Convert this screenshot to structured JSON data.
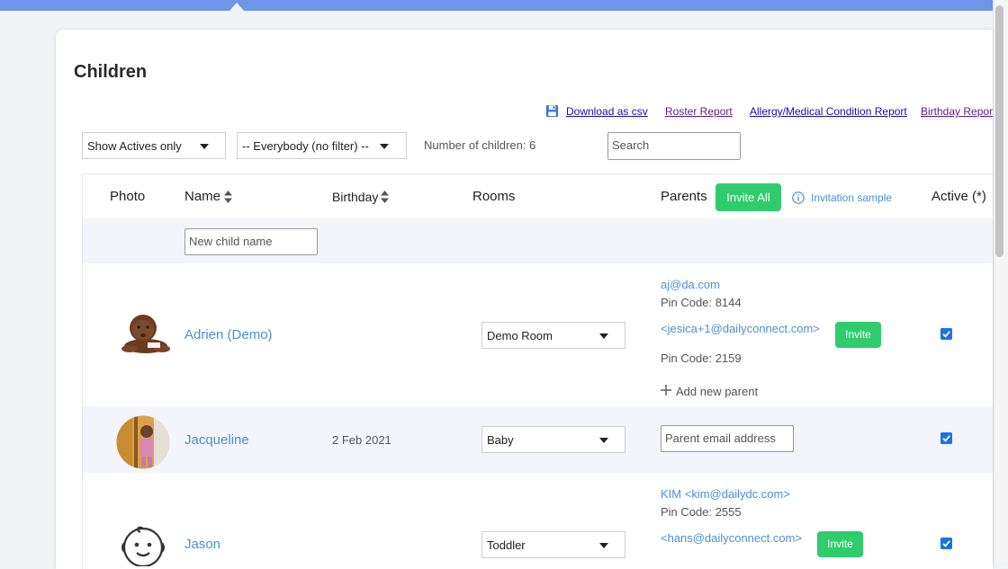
{
  "page": {
    "title": "Children"
  },
  "reports": {
    "csv": "Download as csv",
    "roster": "Roster Report",
    "allergy": "Allergy/Medical Condition Report",
    "birthday": "Birthday Report"
  },
  "filters": {
    "status": "Show Actives only",
    "group": "-- Everybody (no filter) --",
    "count_text": "Number of children: 6",
    "search_placeholder": "Search"
  },
  "table": {
    "headers": {
      "photo": "Photo",
      "name": "Name",
      "birthday": "Birthday",
      "rooms": "Rooms",
      "parents": "Parents",
      "active": "Active (*)"
    },
    "invite_all": "Invite All",
    "invitation_sample": "Invitation sample",
    "new_child_placeholder": "New child name"
  },
  "children": [
    {
      "name": "Adrien (Demo)",
      "birthday": "",
      "room": "Demo Room",
      "parents": [
        {
          "email": "aj@da.com",
          "pin": "Pin Code: 8144"
        },
        {
          "email": "<jesica+1@dailyconnect.com>",
          "pin": "Pin Code: 2159",
          "invite": "Invite"
        }
      ],
      "add_parent": "Add new parent",
      "active": true
    },
    {
      "name": "Jacqueline",
      "birthday": "2 Feb 2021",
      "room": "Baby",
      "parent_placeholder": "Parent email address",
      "active": true
    },
    {
      "name": "Jason",
      "birthday": "",
      "room": "Toddler",
      "parents": [
        {
          "email": "KIM <kim@dailydc.com>",
          "pin": "Pin Code: 2555"
        },
        {
          "email": "<hans@dailyconnect.com>",
          "invite": "Invite"
        }
      ],
      "active": true
    }
  ],
  "colors": {
    "accent": "#2fcc6d",
    "link": "#4a90d9",
    "topbar": "#6f95e8"
  }
}
